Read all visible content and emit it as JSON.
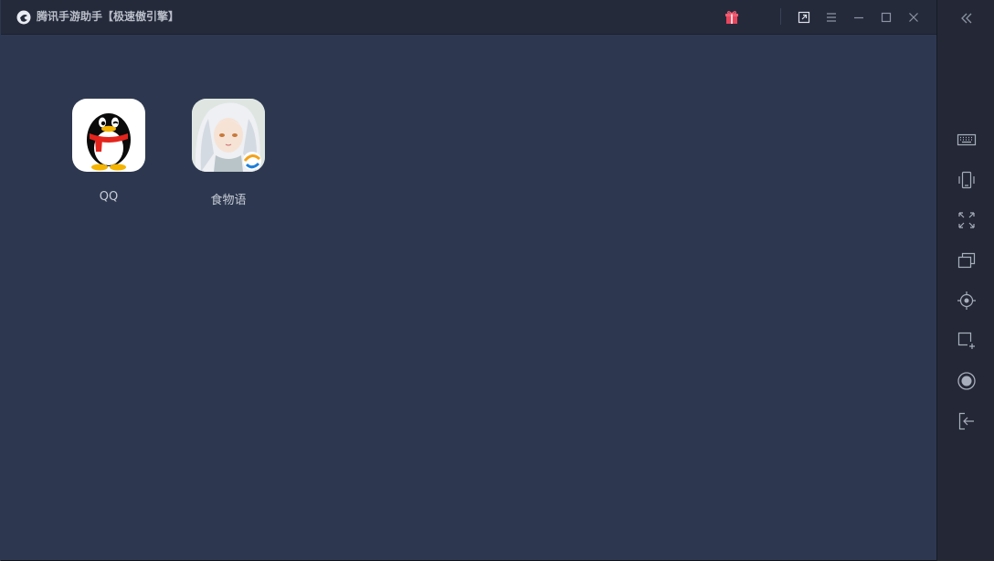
{
  "window": {
    "title": "腾讯手游助手【极速傲引擎】",
    "logo_icon": "tencent-gameassistant-logo",
    "controls": [
      "gift-icon",
      "shortcut-icon",
      "menu-icon",
      "minimize-icon",
      "maximize-icon",
      "close-icon"
    ]
  },
  "apps": [
    {
      "label": "QQ",
      "icon": "qq-penguin-icon"
    },
    {
      "label": "食物语",
      "icon": "shiwuyu-game-icon"
    }
  ],
  "sidebar": {
    "collapse_icon": "double-chevron-left-icon",
    "tools": [
      "keyboard-icon",
      "shake-icon",
      "fullscreen-icon",
      "multi-instance-icon",
      "locate-icon",
      "screenshot-icon",
      "record-icon",
      "exit-icon"
    ]
  },
  "colors": {
    "background": "#2d3850",
    "titlebar": "#252a3b",
    "sidebar": "#242836",
    "gift": "#e8455d"
  }
}
